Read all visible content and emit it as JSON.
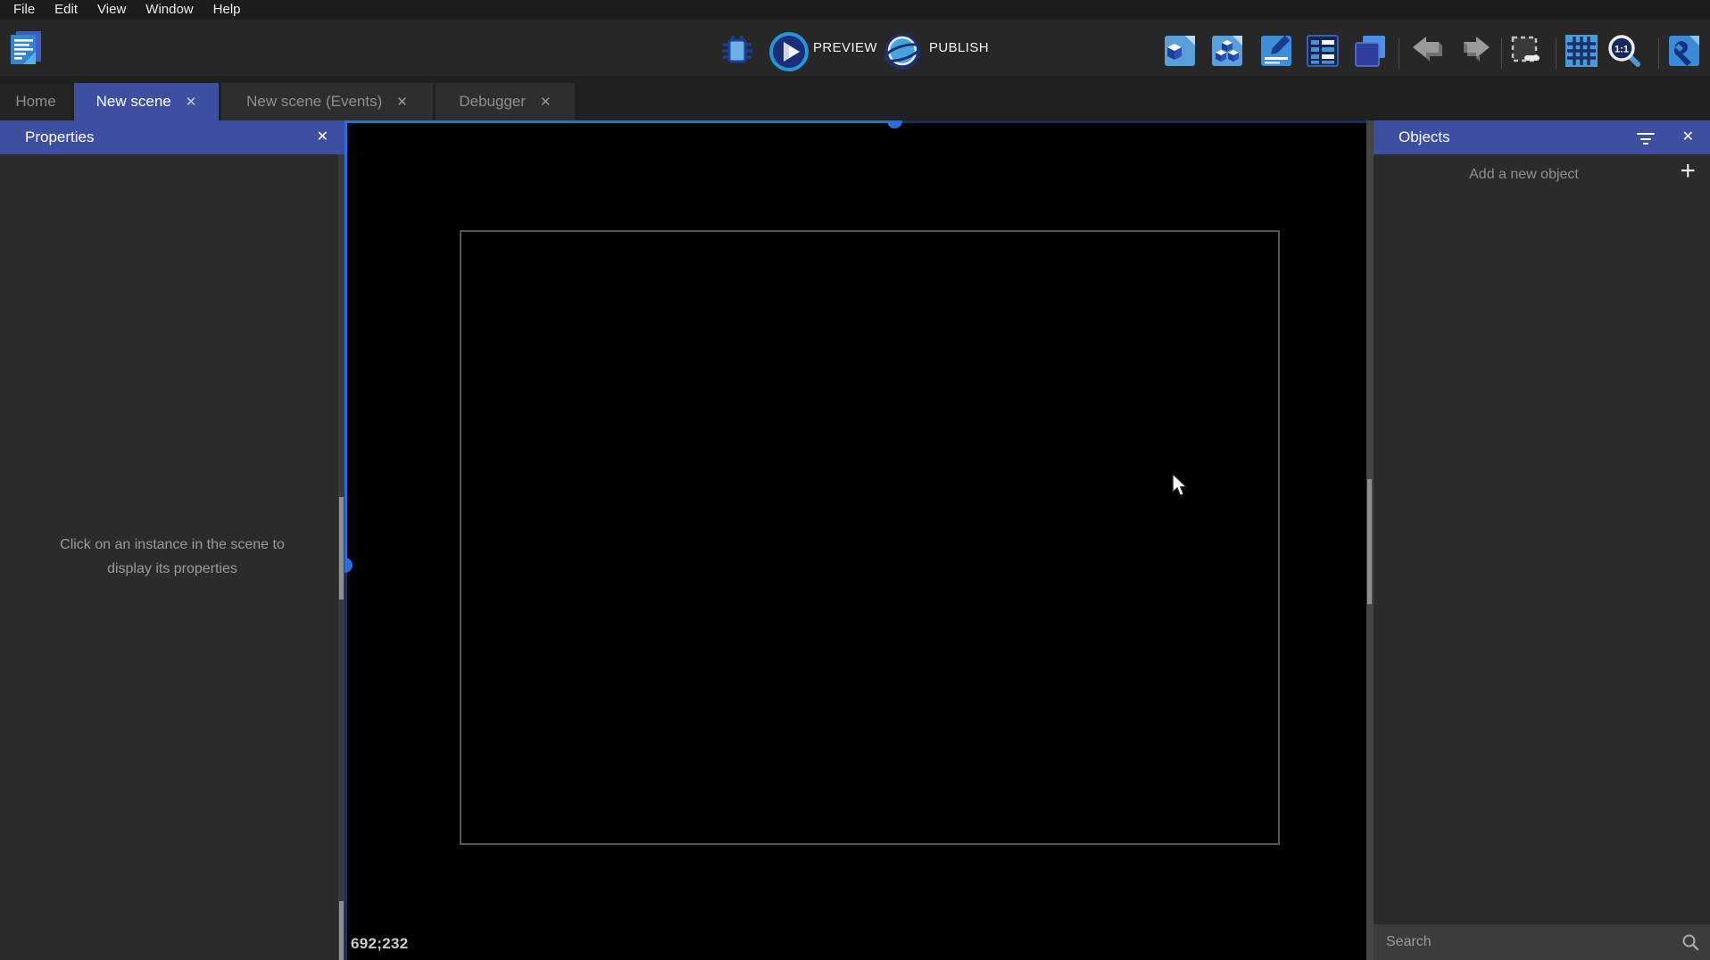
{
  "menu_bar": {
    "items": [
      "File",
      "Edit",
      "View",
      "Window",
      "Help"
    ]
  },
  "toolbar": {
    "preview_label": "PREVIEW",
    "publish_label": "PUBLISH",
    "zoom_label": "1:1",
    "right_icons": [
      "open-objects-editor",
      "open-object-groups-editor",
      "open-properties-panel",
      "open-instances-list",
      "open-layers-editor",
      "undo",
      "redo",
      "delete-selection",
      "toggle-grid",
      "zoom-1-1",
      "scene-properties"
    ]
  },
  "tabs": [
    {
      "label": "Home",
      "active": false,
      "closable": false
    },
    {
      "label": "New scene",
      "active": true,
      "closable": true
    },
    {
      "label": "New scene (Events)",
      "active": false,
      "closable": true
    },
    {
      "label": "Debugger",
      "active": false,
      "closable": true
    }
  ],
  "properties_panel": {
    "title": "Properties",
    "empty_message_line1": "Click on an instance in the scene to",
    "empty_message_line2": "display its properties"
  },
  "objects_panel": {
    "title": "Objects",
    "add_button_label": "Add a new object",
    "search_placeholder": "Search"
  },
  "canvas": {
    "cursor_coordinates": "692;232"
  },
  "glyphs": {
    "close": "✕",
    "plus": "+"
  },
  "icons": {
    "project-manager-icon": "layered-document",
    "debug-icon": "bug",
    "preview-icon": "play-circle",
    "publish-icon": "globe-orbit",
    "objects-editor-icon": "page-with-cube",
    "object-groups-icon": "page-with-cubes",
    "properties-icon": "page-with-pencil",
    "instances-list-icon": "list-table",
    "layers-icon": "stacked-squares",
    "undo-icon": "arrow-left",
    "redo-icon": "arrow-right",
    "delete-selection-icon": "dashed-square-minus",
    "grid-icon": "grid",
    "zoom-icon": "magnifier-1-1",
    "scene-properties-icon": "page-with-wrench",
    "filter-icon": "tune-sliders",
    "search-icon": "magnifier",
    "close-icon": "x",
    "add-icon": "plus"
  },
  "colors": {
    "header_blue": "#3e4ea0",
    "active_tab_blue": "#3d4fa1",
    "accent_blue": "#2d6ce0",
    "track_navy": "#1c2b58",
    "canvas_black": "#000000",
    "panel_gray": "#2b2b2b",
    "toolbar_gray": "#272727"
  }
}
